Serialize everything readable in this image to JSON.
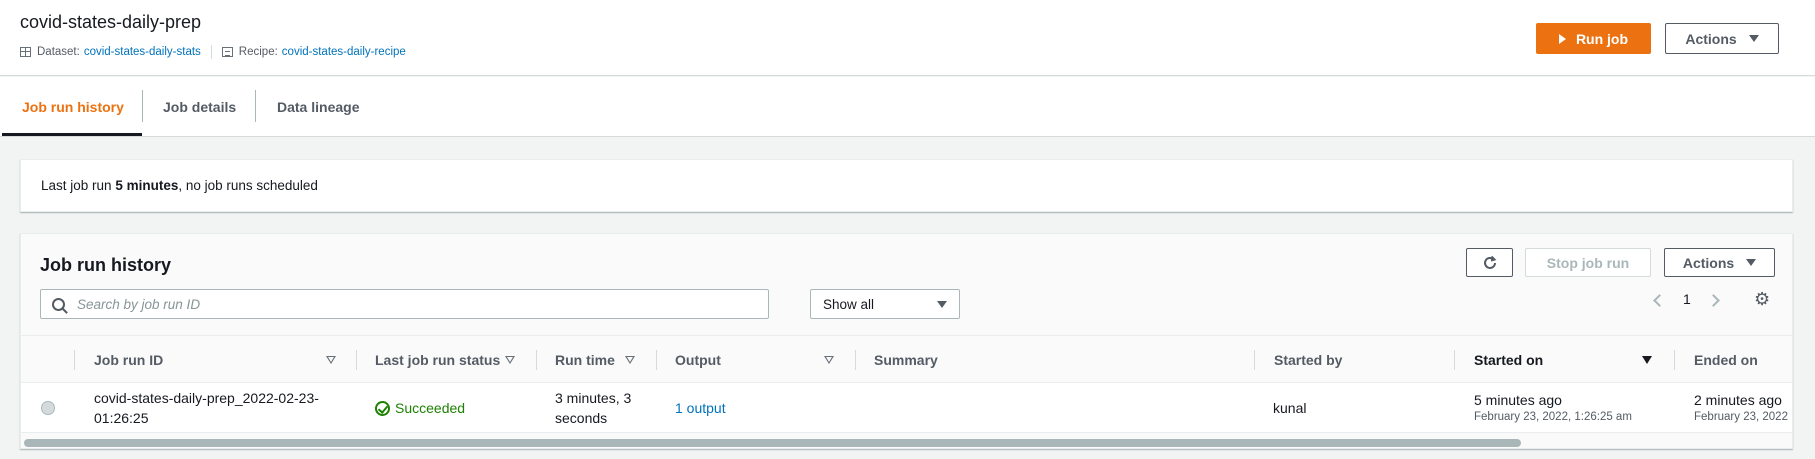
{
  "header": {
    "title": "covid-states-daily-prep",
    "dataset_label": "Dataset:",
    "dataset_value": "covid-states-daily-stats",
    "recipe_label": "Recipe:",
    "recipe_value": "covid-states-daily-recipe",
    "run_job_label": "Run job",
    "actions_label": "Actions"
  },
  "tabs": [
    {
      "label": "Job run history",
      "active": true
    },
    {
      "label": "Job details",
      "active": false
    },
    {
      "label": "Data lineage",
      "active": false
    }
  ],
  "info": {
    "prefix": "Last job run",
    "bold": "5 minutes",
    "suffix": ", no job runs scheduled"
  },
  "history": {
    "title": "Job run history",
    "search_placeholder": "Search by job run ID",
    "filter_value": "Show all",
    "stop_label": "Stop job run",
    "actions_label": "Actions",
    "page_number": "1",
    "columns": [
      "Job run ID",
      "Last job run status",
      "Run time",
      "Output",
      "Summary",
      "Started by",
      "Started on",
      "Ended on"
    ],
    "rows": [
      {
        "job_run_id": "covid-states-daily-prep_2022-02-23-01:26:25",
        "job_run_id_line1": "covid-states-daily-prep_2022-02-23-",
        "job_run_id_line2": "01:26:25",
        "status": "Succeeded",
        "run_time_line1": "3 minutes, 3",
        "run_time_line2": "seconds",
        "output": "1 output",
        "summary": "",
        "started_by": "kunal",
        "started_on": "5 minutes ago",
        "started_on_detail": "February 23, 2022, 1:26:25 am",
        "ended_on": "2 minutes ago",
        "ended_on_detail": "February 23, 2022"
      }
    ]
  },
  "colors": {
    "accent": "#ec7211",
    "link": "#0073bb",
    "success": "#1d8102"
  }
}
